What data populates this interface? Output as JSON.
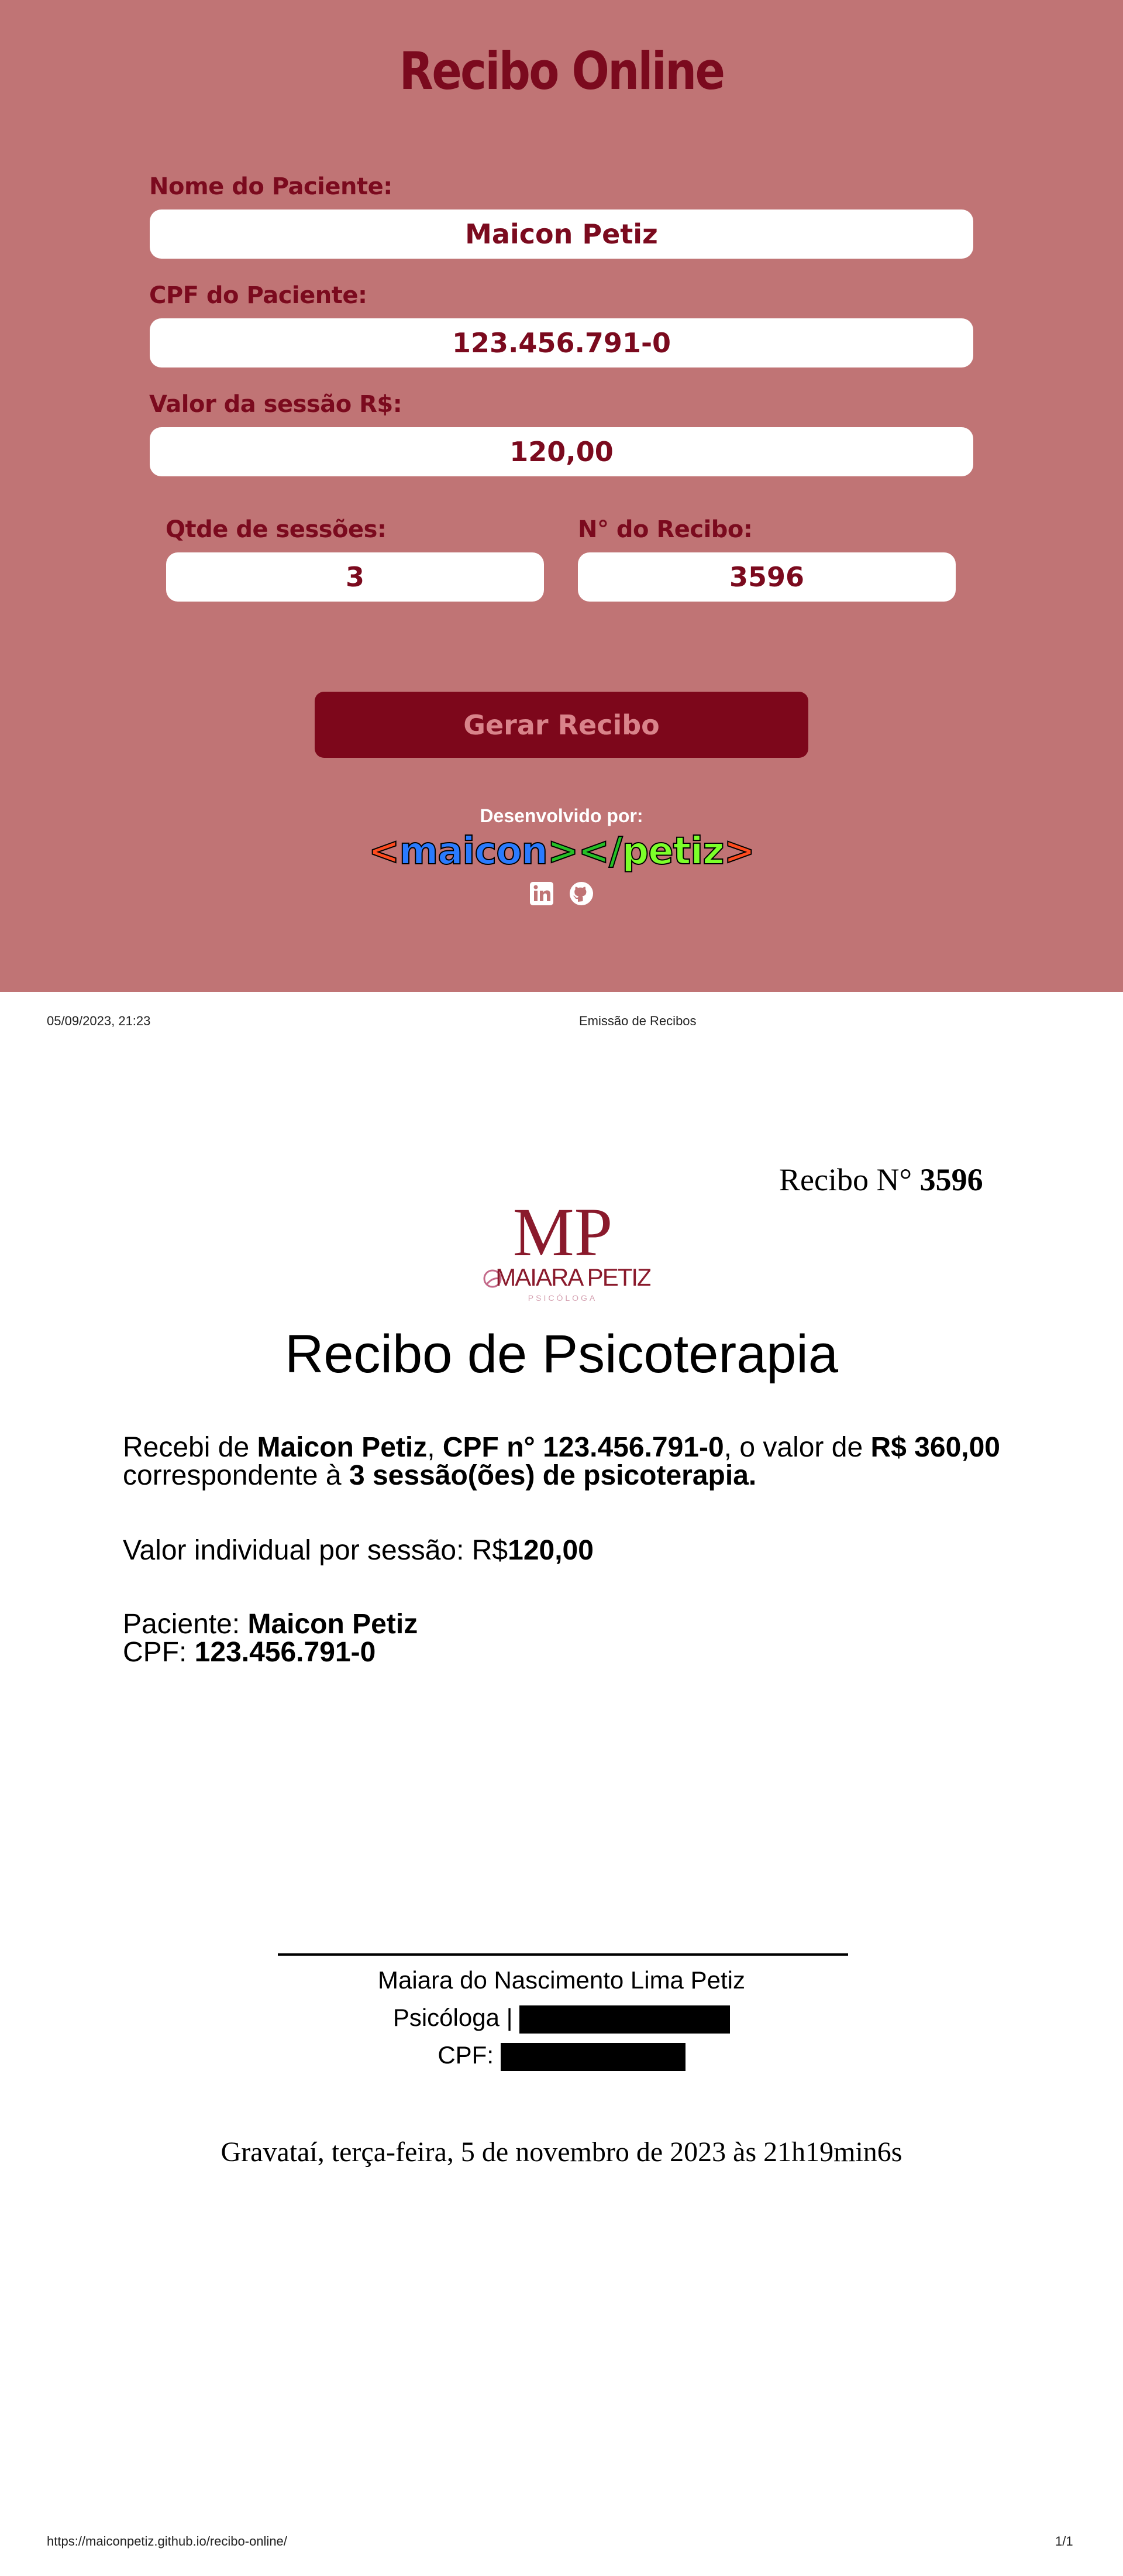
{
  "app": {
    "title": "Recibo Online"
  },
  "form": {
    "patient_name_label": "Nome do Paciente:",
    "patient_name_value": "Maicon Petiz",
    "patient_cpf_label": "CPF do Paciente:",
    "patient_cpf_value": "123.456.791-0",
    "session_value_label": "Valor da sessão R$:",
    "session_value_value": "120,00",
    "session_qty_label": "Qtde de sessões:",
    "session_qty_value": "3",
    "receipt_number_label": "N° do Recibo:",
    "receipt_number_value": "3596",
    "generate_button": "Gerar Recibo"
  },
  "footer": {
    "developed_by": "Desenvolvido por:",
    "logo": {
      "open": "<",
      "name1": "maicon",
      "mid": "></",
      "name2": "petiz",
      "close": ">"
    },
    "social_icons": [
      "linkedin-icon",
      "github-icon"
    ]
  },
  "print": {
    "header_date": "05/09/2023, 21:23",
    "header_title": "Emissão de Recibos",
    "receipt_label": "Recibo N°",
    "receipt_number": "3596",
    "brand": {
      "monogram": "MP",
      "name": "MAIARA PETIZ",
      "tagline": "PSICÓLOGA"
    },
    "doc_title": "Recibo de Psicoterapia",
    "body": {
      "p1_a": "Recebi de ",
      "p1_name": "Maicon Petiz",
      "p1_b": ", ",
      "p1_cpf": "CPF n° 123.456.791-0",
      "p1_c": ", o valor de ",
      "p1_total": "R$ 360,00",
      "p1_d": " correspondente à ",
      "p1_sessions": "3 sessão(ões) de psicoterapia.",
      "p2_label": "Valor individual por sessão: ",
      "p2_value_prefix": "R$",
      "p2_value": "120,00",
      "p3_label": "Paciente: ",
      "p3_value": "Maicon Petiz",
      "p4_label": "CPF: ",
      "p4_value": "123.456.791-0"
    },
    "signature": {
      "name": "Maiara do Nascimento Lima Petiz",
      "role_label": "Psicóloga | ",
      "cpf_label": "CPF: "
    },
    "place_date": "Gravataí, terça-feira, 5 de novembro de 2023 às 21h19min6s",
    "footer_url": "https://maiconpetiz.github.io/recibo-online/",
    "footer_page": "1/1"
  },
  "colors": {
    "form_bg": "#c07475",
    "accent": "#7b0a1e",
    "button_bg": "#7d071b",
    "button_text": "#d9838a"
  }
}
